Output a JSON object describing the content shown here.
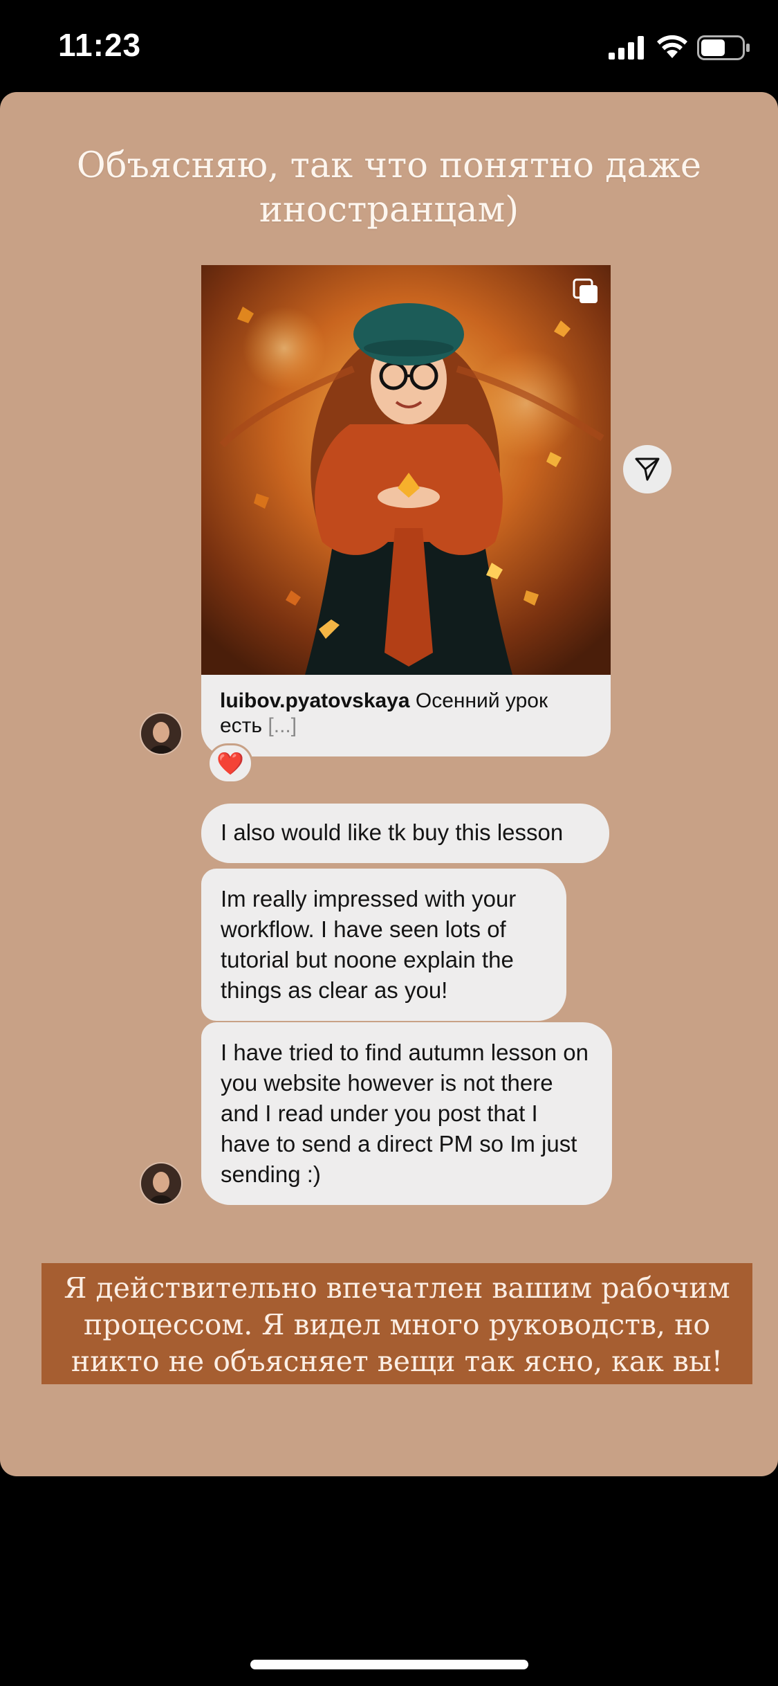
{
  "status_bar": {
    "time": "11:23",
    "icons": [
      "signal-icon",
      "wifi-icon",
      "battery-icon"
    ]
  },
  "story": {
    "title": "Объясняю, так что понятно даже иностранцам)",
    "background_color": "#c8a186"
  },
  "post": {
    "username": "luibov.pyatovskaya",
    "caption": "Осенний урок есть",
    "more": "[...]",
    "image_description": "girl-in-autumn-leaves",
    "icons": [
      "multiple-photos-icon",
      "share-icon"
    ]
  },
  "reaction": {
    "emoji": "❤️"
  },
  "messages": [
    {
      "text": "I also would like tk buy this lesson"
    },
    {
      "text": "Im really impressed with your workflow. I have seen lots of tutorial but noone explain the things as clear as you!"
    },
    {
      "text": "I have tried to find autumn lesson on you website however is not there and I read under you post that I have to send a direct PM so Im just sending :)"
    }
  ],
  "translation": {
    "text": "Я действительно впечатлен вашим рабочим процессом. Я видел много руководств, но никто не объясняет вещи так ясно, как вы!",
    "background_color": "#a65e31"
  }
}
